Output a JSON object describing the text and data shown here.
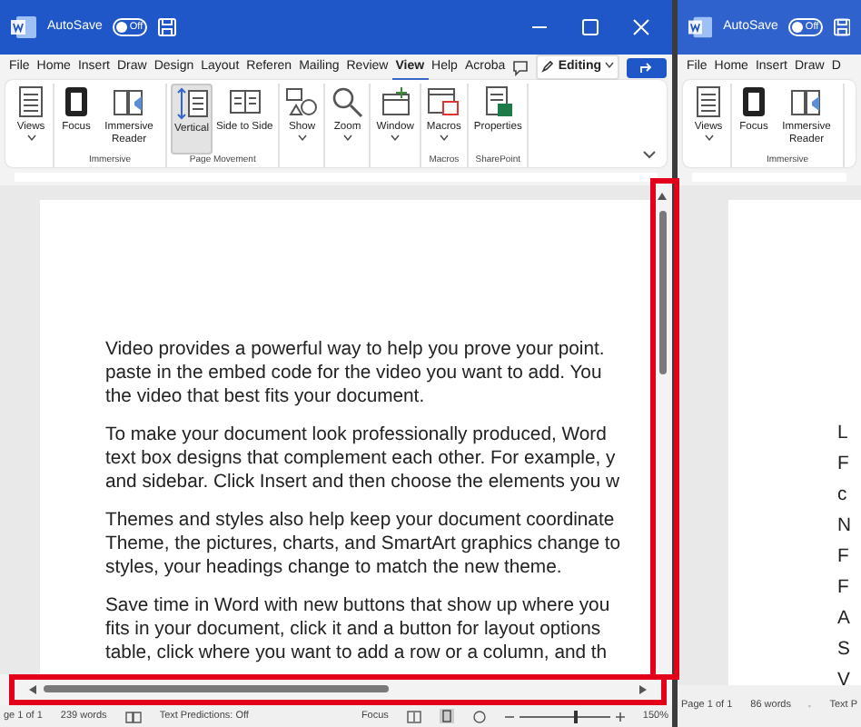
{
  "main_window": {
    "autosave": {
      "label": "AutoSave",
      "state_text": "Off",
      "on": false
    },
    "tabs": [
      {
        "label": "File",
        "selected": false
      },
      {
        "label": "Home",
        "selected": false
      },
      {
        "label": "Insert",
        "selected": false
      },
      {
        "label": "Draw",
        "selected": false
      },
      {
        "label": "Design",
        "selected": false
      },
      {
        "label": "Layout",
        "selected": false
      },
      {
        "label": "Referen",
        "selected": false
      },
      {
        "label": "Mailing",
        "selected": false
      },
      {
        "label": "Review",
        "selected": false
      },
      {
        "label": "View",
        "selected": true
      },
      {
        "label": "Help",
        "selected": false
      },
      {
        "label": "Acroba",
        "selected": false
      }
    ],
    "editing_button": "Editing",
    "ribbon_groups": [
      {
        "commands": [
          {
            "label": "Views",
            "kind": "views",
            "dropdown": true
          }
        ]
      },
      {
        "label": "Immersive",
        "commands": [
          {
            "label": "Focus",
            "kind": "focus",
            "dropdown": false
          },
          {
            "label": "Immersive Reader",
            "kind": "reader",
            "dropdown": false
          }
        ]
      },
      {
        "label": "Page Movement",
        "commands": [
          {
            "label": "Vertical",
            "kind": "vertical",
            "dropdown": false,
            "selected": true
          },
          {
            "label": "Side to Side",
            "kind": "side",
            "dropdown": false,
            "selected": false
          }
        ]
      },
      {
        "commands": [
          {
            "label": "Show",
            "kind": "show",
            "dropdown": true
          }
        ]
      },
      {
        "commands": [
          {
            "label": "Zoom",
            "kind": "zoom",
            "dropdown": true
          }
        ]
      },
      {
        "commands": [
          {
            "label": "Window",
            "kind": "window",
            "dropdown": true
          }
        ]
      },
      {
        "label": "Macros",
        "commands": [
          {
            "label": "Macros",
            "kind": "macros",
            "dropdown": true
          }
        ]
      },
      {
        "label": "SharePoint",
        "commands": [
          {
            "label": "Properties",
            "kind": "properties",
            "dropdown": false
          }
        ]
      }
    ],
    "document": {
      "paragraphs": [
        [
          "Video provides a powerful way to help you prove your point.",
          "paste in the embed code for the video you want to add. You",
          "the video that best fits your document."
        ],
        [
          "To make your document look professionally produced, Word",
          "text box designs that complement each other. For example, y",
          "and sidebar. Click Insert and then choose the elements you w"
        ],
        [
          "Themes and styles also help keep your document coordinate",
          "Theme, the pictures, charts, and SmartArt graphics change to",
          "styles, your headings change to match the new theme."
        ],
        [
          "Save time in Word with new buttons that show up where you",
          "fits in your document, click it and a button for layout options",
          "table, click where you want to add a row or a column, and th"
        ]
      ]
    },
    "status_bar": {
      "page": "ge 1 of 1",
      "words": "239 words",
      "text_predictions": "Text Predictions: Off",
      "focus": "Focus",
      "zoom_slider": {
        "level": 0.6
      },
      "zoom": "150%"
    }
  },
  "second_window": {
    "autosave": {
      "label": "AutoSave",
      "state_text": "Off",
      "on": false
    },
    "tabs": [
      {
        "label": "File",
        "selected": false
      },
      {
        "label": "Home",
        "selected": false
      },
      {
        "label": "Insert",
        "selected": false
      },
      {
        "label": "Draw",
        "selected": false
      },
      {
        "label": "D",
        "selected": false
      }
    ],
    "ribbon_groups": [
      {
        "commands": [
          {
            "label": "Views",
            "kind": "views",
            "dropdown": true
          }
        ]
      },
      {
        "label": "Immersive",
        "commands": [
          {
            "label": "Focus",
            "kind": "focus",
            "dropdown": false
          },
          {
            "label": "Immersive Reader",
            "kind": "reader",
            "dropdown": false
          }
        ]
      }
    ],
    "document": {
      "lines": [
        "L",
        "F",
        "c",
        "N",
        "F",
        "F",
        "A",
        "S",
        "V"
      ]
    },
    "status_bar": {
      "page": "Page 1 of 1",
      "words": "86 words",
      "text_predictions": "Text P"
    }
  }
}
